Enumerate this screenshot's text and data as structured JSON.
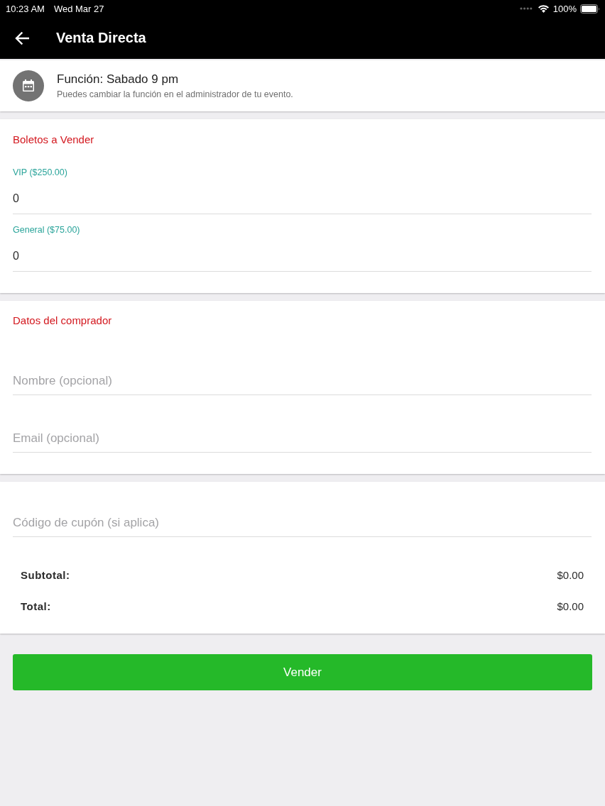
{
  "status_bar": {
    "time": "10:23 AM",
    "date": "Wed Mar 27",
    "battery": "100%"
  },
  "app_bar": {
    "title": "Venta Directa"
  },
  "function_card": {
    "title": "Función: Sabado 9 pm",
    "subtitle": "Puedes cambiar la función en el administrador de tu evento."
  },
  "tickets": {
    "heading": "Boletos a Vender",
    "fields": [
      {
        "label": "VIP ($250.00)",
        "value": "0"
      },
      {
        "label": "General ($75.00)",
        "value": "0"
      }
    ]
  },
  "buyer": {
    "heading": "Datos del comprador",
    "fields": [
      {
        "placeholder": "Nombre (opcional)"
      },
      {
        "placeholder": "Email (opcional)"
      }
    ]
  },
  "checkout": {
    "coupon": {
      "placeholder": "Código de cupón (si aplica)"
    },
    "totals": [
      {
        "label": "Subtotal:",
        "amount": "$0.00"
      },
      {
        "label": "Total:",
        "amount": "$0.00"
      }
    ]
  },
  "submit_button": {
    "label": "Vender"
  }
}
